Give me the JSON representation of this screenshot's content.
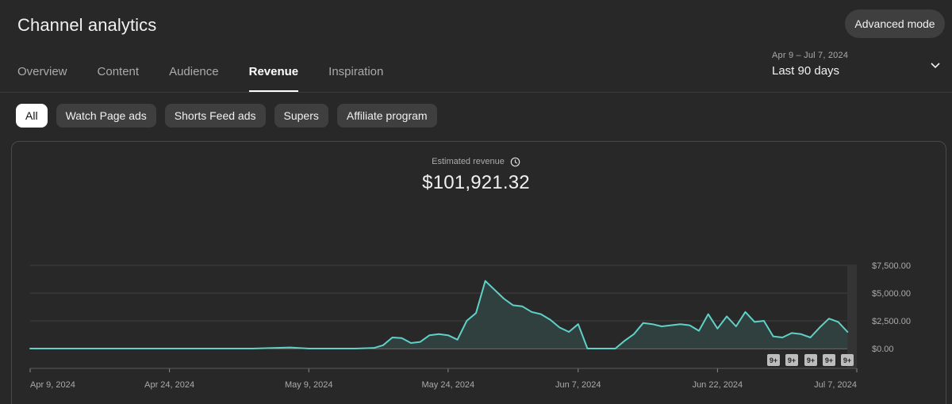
{
  "header": {
    "title": "Channel analytics",
    "advanced_mode_label": "Advanced mode"
  },
  "tabs": [
    {
      "label": "Overview",
      "active": false
    },
    {
      "label": "Content",
      "active": false
    },
    {
      "label": "Audience",
      "active": false
    },
    {
      "label": "Revenue",
      "active": true
    },
    {
      "label": "Inspiration",
      "active": false
    }
  ],
  "date_range": {
    "range_text": "Apr 9 – Jul 7, 2024",
    "label": "Last 90 days",
    "icon": "chevron-down-icon"
  },
  "chips": [
    {
      "label": "All",
      "selected": true
    },
    {
      "label": "Watch Page ads",
      "selected": false
    },
    {
      "label": "Shorts Feed ads",
      "selected": false
    },
    {
      "label": "Supers",
      "selected": false
    },
    {
      "label": "Affiliate program",
      "selected": false
    }
  ],
  "metric": {
    "label": "Estimated revenue",
    "value": "$101,921.32",
    "icon": "clock-icon"
  },
  "colors": {
    "background": "#282828",
    "line": "#5fd1c8",
    "fill": "#314241",
    "grid": "#3f3f3f",
    "badge": "#bdbdbd"
  },
  "chart_data": {
    "type": "area",
    "x_tick_labels": [
      "Apr 9, 2024",
      "Apr 24, 2024",
      "May 9, 2024",
      "May 24, 2024",
      "Jun 7, 2024",
      "Jun 22, 2024",
      "Jul 7, 2024"
    ],
    "y_tick_labels": [
      "$0.00",
      "$2,500.00",
      "$5,000.00",
      "$7,500.00"
    ],
    "ylim": [
      0,
      7500
    ],
    "x_start": "2024-04-09",
    "x_end": "2024-07-07",
    "markers": [
      "9+",
      "9+",
      "9+",
      "9+",
      "9+"
    ],
    "series": [
      {
        "points": [
          [
            "2024-04-09",
            0
          ],
          [
            "2024-04-15",
            0
          ],
          [
            "2024-04-21",
            0
          ],
          [
            "2024-04-27",
            0
          ],
          [
            "2024-05-03",
            0
          ],
          [
            "2024-05-07",
            100
          ],
          [
            "2024-05-09",
            0
          ],
          [
            "2024-05-14",
            0
          ],
          [
            "2024-05-16",
            50
          ],
          [
            "2024-05-17",
            300
          ],
          [
            "2024-05-18",
            1000
          ],
          [
            "2024-05-19",
            950
          ],
          [
            "2024-05-20",
            500
          ],
          [
            "2024-05-21",
            600
          ],
          [
            "2024-05-22",
            1200
          ],
          [
            "2024-05-23",
            1300
          ],
          [
            "2024-05-24",
            1200
          ],
          [
            "2024-05-25",
            800
          ],
          [
            "2024-05-26",
            2500
          ],
          [
            "2024-05-27",
            3200
          ],
          [
            "2024-05-28",
            6100
          ],
          [
            "2024-05-29",
            5300
          ],
          [
            "2024-05-30",
            4500
          ],
          [
            "2024-05-31",
            3900
          ],
          [
            "2024-06-01",
            3800
          ],
          [
            "2024-06-02",
            3300
          ],
          [
            "2024-06-03",
            3100
          ],
          [
            "2024-06-04",
            2600
          ],
          [
            "2024-06-05",
            1900
          ],
          [
            "2024-06-06",
            1500
          ],
          [
            "2024-06-07",
            2200
          ],
          [
            "2024-06-08",
            0
          ],
          [
            "2024-06-11",
            0
          ],
          [
            "2024-06-12",
            700
          ],
          [
            "2024-06-13",
            1300
          ],
          [
            "2024-06-14",
            2300
          ],
          [
            "2024-06-15",
            2200
          ],
          [
            "2024-06-16",
            2000
          ],
          [
            "2024-06-17",
            2100
          ],
          [
            "2024-06-18",
            2200
          ],
          [
            "2024-06-19",
            2100
          ],
          [
            "2024-06-20",
            1600
          ],
          [
            "2024-06-21",
            3100
          ],
          [
            "2024-06-22",
            1800
          ],
          [
            "2024-06-23",
            2900
          ],
          [
            "2024-06-24",
            2000
          ],
          [
            "2024-06-25",
            3300
          ],
          [
            "2024-06-26",
            2400
          ],
          [
            "2024-06-27",
            2500
          ],
          [
            "2024-06-28",
            1100
          ],
          [
            "2024-06-29",
            1000
          ],
          [
            "2024-06-30",
            1400
          ],
          [
            "2024-07-01",
            1300
          ],
          [
            "2024-07-02",
            1000
          ],
          [
            "2024-07-03",
            1900
          ],
          [
            "2024-07-04",
            2700
          ],
          [
            "2024-07-05",
            2400
          ],
          [
            "2024-07-06",
            1500
          ]
        ]
      }
    ]
  }
}
